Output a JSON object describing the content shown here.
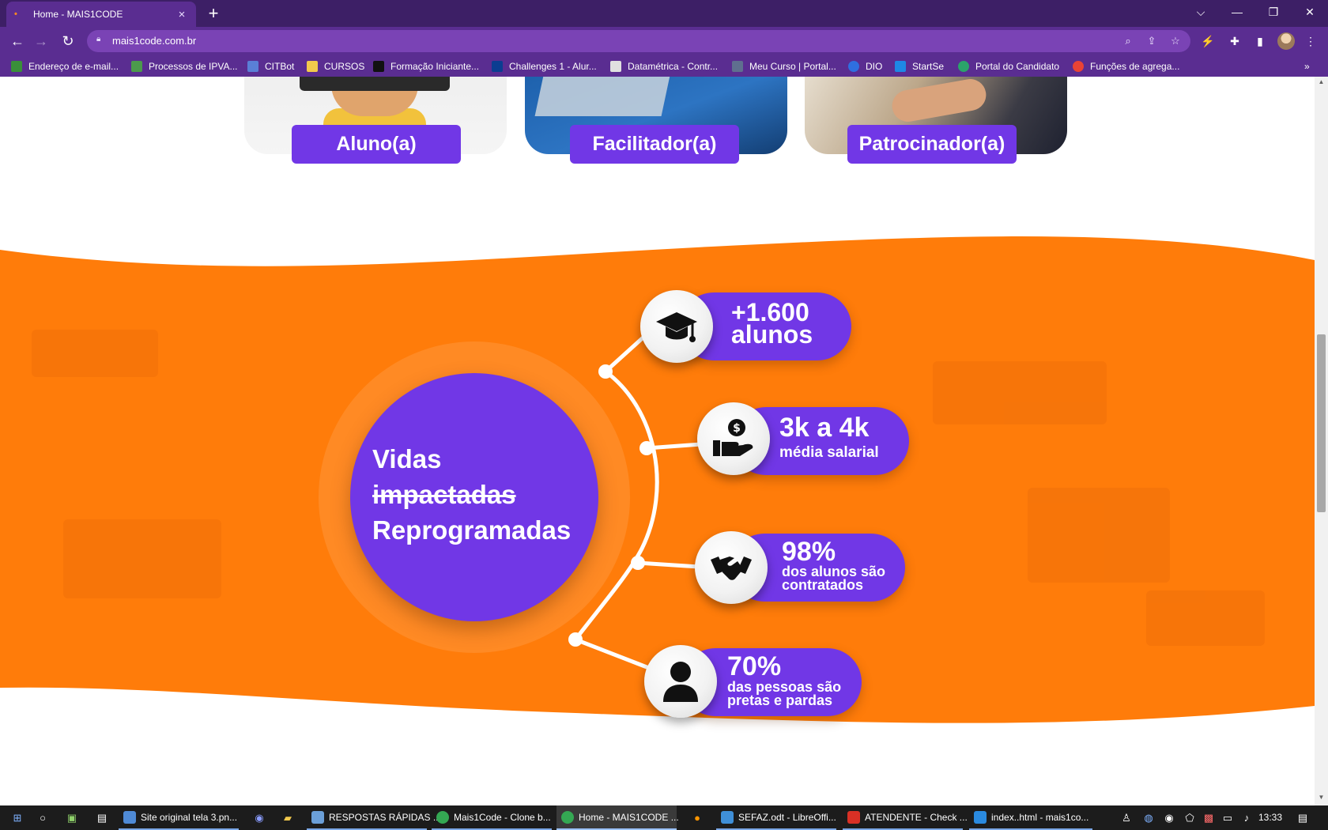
{
  "browser": {
    "tab_title": "Home - MAIS1CODE",
    "tab_close": "×",
    "new_tab": "+",
    "url": "mais1code.com.br",
    "window_controls": [
      "⌵",
      "—",
      "❐",
      "✕"
    ]
  },
  "bookmarks": [
    {
      "label": "Endereço de e-mail...",
      "color": "#3a8f3a"
    },
    {
      "label": "Processos de IPVA...",
      "color": "#4c9a4c"
    },
    {
      "label": "CITBot",
      "color": "#5a7fd6"
    },
    {
      "label": "CURSOS",
      "color": "#f2c94c"
    },
    {
      "label": "Formação Iniciante...",
      "color": "#111111"
    },
    {
      "label": "Challenges 1 - Alur...",
      "color": "#0b3d91"
    },
    {
      "label": "Datamétrica - Contr...",
      "color": "#e0e0e0"
    },
    {
      "label": "Meu Curso | Portal...",
      "color": "#5f6f8f"
    },
    {
      "label": "DIO",
      "color": "#2f6fe0"
    },
    {
      "label": "StartSe",
      "color": "#1e88e5"
    },
    {
      "label": "Portal do Candidato",
      "color": "#2ba36a"
    },
    {
      "label": "Funções de agrega...",
      "color": "#ea4335"
    }
  ],
  "roles": [
    "Aluno(a)",
    "Facilitador(a)",
    "Patrocinador(a)"
  ],
  "impact": {
    "line1": "Vidas",
    "line2": "impactadas",
    "line3": "Reprogramadas"
  },
  "stats": [
    {
      "big": "+1.600",
      "big2": "alunos",
      "icon": "graduation-cap-icon"
    },
    {
      "big": "3k a 4k",
      "small": "média salarial",
      "icon": "money-hand-icon"
    },
    {
      "big": "98%",
      "small": "dos alunos são",
      "small2": "contratados",
      "icon": "handshake-icon"
    },
    {
      "big": "70%",
      "small": "das pessoas são",
      "small2": "pretas e pardas",
      "icon": "person-icon"
    }
  ],
  "colors": {
    "purple": "#7137e6",
    "orange": "#ff7c0a",
    "browser_purple": "#5a2d91"
  },
  "taskbar": {
    "items": [
      "Site original tela 3.pn...",
      "RESPOSTAS RÁPIDAS ...",
      "Mais1Code - Clone b...",
      "Home - MAIS1CODE ...",
      "SEFAZ.odt - LibreOffi...",
      "ATENDENTE - Check ...",
      "index..html - mais1co..."
    ],
    "clock": "13:33"
  }
}
